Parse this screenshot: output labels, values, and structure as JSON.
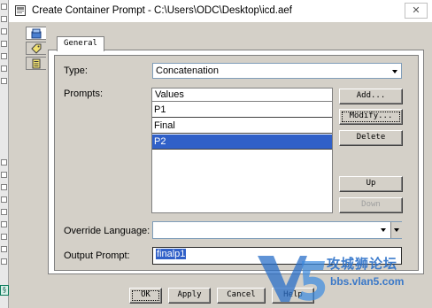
{
  "window": {
    "title": "Create Container Prompt - C:\\Users\\ODC\\Desktop\\icd.aef",
    "close_glyph": "✕"
  },
  "vertical_toolbar": {
    "icons": [
      "container-icon",
      "tag-icon",
      "document-icon"
    ]
  },
  "tabs": [
    {
      "label": "General",
      "selected": true
    }
  ],
  "form": {
    "type_label": "Type:",
    "type_value": "Concatenation",
    "prompts_label": "Prompts:",
    "prompts_list": {
      "header": "Values",
      "rows": [
        {
          "label": "P1",
          "selected": false
        },
        {
          "label": "Final",
          "selected": false
        },
        {
          "label": "P2",
          "selected": true
        }
      ]
    },
    "override_language_label": "Override Language:",
    "override_language_value": "",
    "output_prompt_label": "Output Prompt:",
    "output_prompt_value": "finalp1"
  },
  "side_buttons": {
    "add": "Add...",
    "modify": "Modify...",
    "delete": "Delete",
    "up": "Up",
    "down": "Down"
  },
  "footer_buttons": {
    "ok": "OK",
    "apply": "Apply",
    "cancel": "Cancel",
    "help": "Help"
  },
  "watermark": {
    "text": "攻城狮论坛",
    "url": "bbs.vlan5.com",
    "logo_letters": "V5"
  },
  "colors": {
    "selection": "#3060c8",
    "dialog_bg": "#d4d0c8",
    "watermark": "#2a6fc8"
  }
}
